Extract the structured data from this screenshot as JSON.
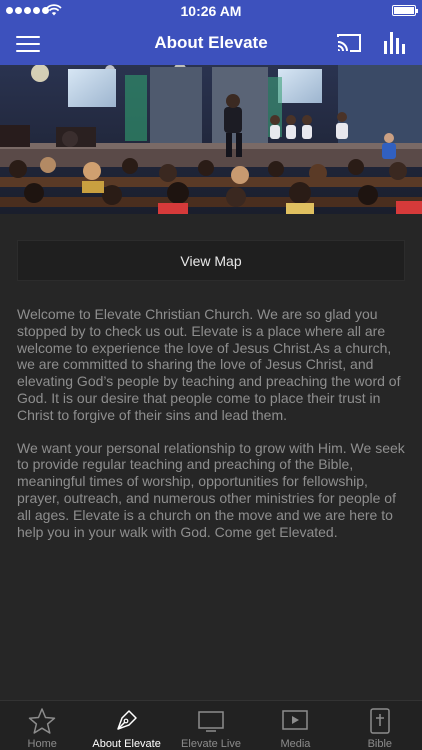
{
  "status_bar": {
    "time": "10:26 AM"
  },
  "nav": {
    "title": "About Elevate"
  },
  "map_button": {
    "label": "View Map"
  },
  "description": {
    "paragraphs": [
      "Welcome to Elevate Christian Church. We are so glad you stopped by to check us out. Elevate is a place where all are welcome to experience the love of Jesus Christ.As a church, we are committed to sharing the love of Jesus Christ, and elevating God’s people by teaching and preaching the word of God. It is our desire that people come to place their trust in Christ to forgive of their sins and lead them.",
      "We want your personal relationship to grow with Him. We seek to provide regular teaching and preaching of the Bible, meaningful times of worship, opportunities for fellowship, prayer, outreach, and numerous other ministries for people of all ages. Elevate is a church on the move and we are here to help you in your walk with God. Come get Elevated."
    ]
  },
  "tabs": [
    {
      "label": "Home",
      "icon": "star-icon",
      "active": false
    },
    {
      "label": "About Elevate",
      "icon": "pen-nib-icon",
      "active": true
    },
    {
      "label": "Elevate Live",
      "icon": "tv-icon",
      "active": false
    },
    {
      "label": "Media",
      "icon": "play-icon",
      "active": false
    },
    {
      "label": "Bible",
      "icon": "bible-icon",
      "active": false
    }
  ],
  "colors": {
    "accent": "#3d51bd",
    "background": "#262626",
    "text_muted": "#8e8e8e"
  }
}
